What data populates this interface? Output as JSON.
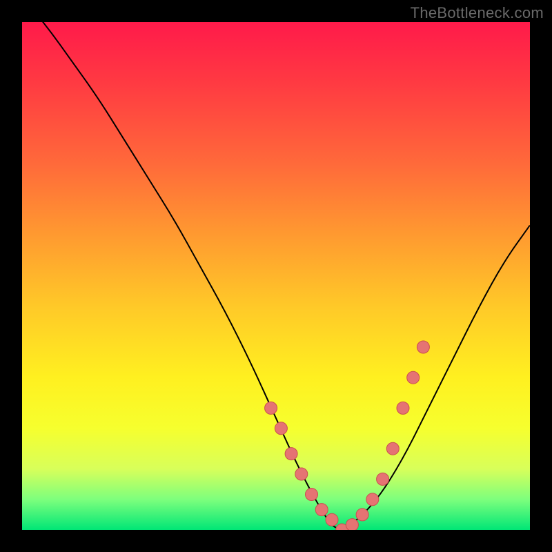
{
  "watermark": "TheBottleneck.com",
  "colors": {
    "grad_top": "#ff1a4a",
    "grad_mid1": "#ff9a30",
    "grad_mid2": "#fff020",
    "grad_bottom": "#00e676",
    "curve_stroke": "#000000",
    "marker_fill": "#e57373",
    "marker_stroke": "#c94f4f",
    "background": "#000000",
    "watermark_text": "#6a6a6a"
  },
  "chart_data": {
    "type": "line",
    "title": "",
    "xlabel": "",
    "ylabel": "",
    "xlim": [
      0,
      100
    ],
    "ylim": [
      0,
      100
    ],
    "series": [
      {
        "name": "bottleneck-curve",
        "x": [
          0,
          5,
          10,
          15,
          20,
          25,
          30,
          35,
          40,
          45,
          50,
          55,
          60,
          62,
          65,
          70,
          75,
          80,
          85,
          90,
          95,
          100
        ],
        "values": [
          105,
          99,
          92,
          85,
          77,
          69,
          61,
          52,
          43,
          33,
          22,
          11,
          2,
          0,
          1,
          6,
          14,
          24,
          34,
          44,
          53,
          60
        ]
      }
    ],
    "markers": {
      "name": "highlighted-points",
      "x": [
        49,
        51,
        53,
        55,
        57,
        59,
        61,
        63,
        65,
        67,
        69,
        71,
        73,
        75,
        77,
        79
      ],
      "values": [
        24,
        20,
        15,
        11,
        7,
        4,
        2,
        0,
        1,
        3,
        6,
        10,
        16,
        24,
        30,
        36
      ]
    }
  }
}
